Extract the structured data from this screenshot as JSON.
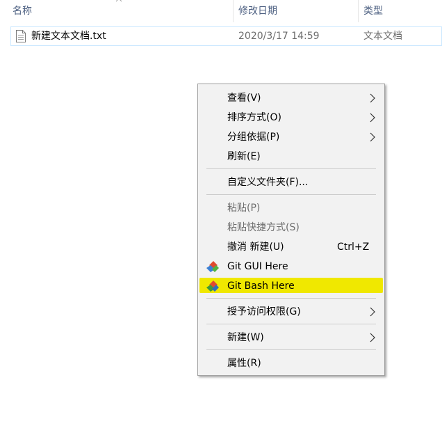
{
  "columns": {
    "name": "名称",
    "date": "修改日期",
    "type": "类型"
  },
  "file": {
    "name": "新建文本文档.txt",
    "date": "2020/3/17 14:59",
    "type": "文本文档"
  },
  "menu": {
    "view": "查看(V)",
    "sort": "排序方式(O)",
    "group": "分组依据(P)",
    "refresh": "刷新(E)",
    "customize": "自定义文件夹(F)...",
    "paste": "粘贴(P)",
    "paste_shortcut": "粘贴快捷方式(S)",
    "undo": "撤消 新建(U)",
    "undo_shortcut": "Ctrl+Z",
    "git_gui": "Git GUI Here",
    "git_bash": "Git Bash Here",
    "grant_access": "授予访问权限(G)",
    "new": "新建(W)",
    "properties": "属性(R)"
  },
  "colors": {
    "highlight": "#f0e800",
    "menu_bg": "#f2f2f2",
    "header_text": "#4d6082"
  }
}
